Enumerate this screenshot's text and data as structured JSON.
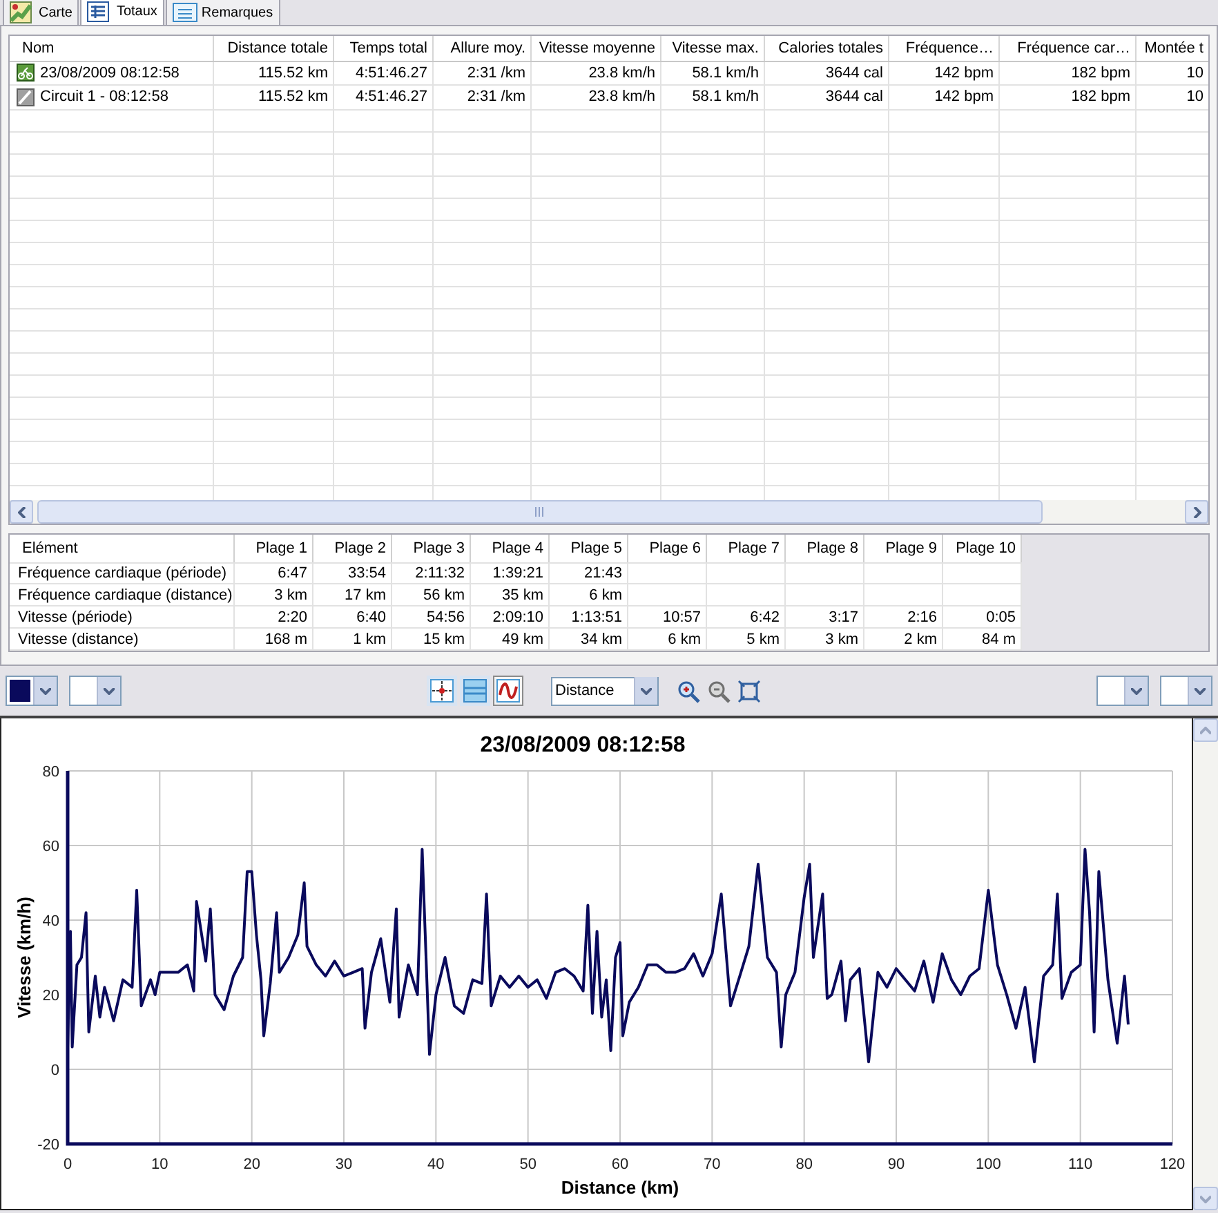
{
  "tabs": [
    {
      "label": "Carte",
      "kind": "map",
      "selected": false
    },
    {
      "label": "Totaux",
      "kind": "table",
      "selected": true
    },
    {
      "label": "Remarques",
      "kind": "notes",
      "selected": false
    }
  ],
  "totals_table": {
    "columns": [
      "Nom",
      "Distance totale",
      "Temps total",
      "Allure moy.",
      "Vitesse moyenne",
      "Vitesse max.",
      "Calories totales",
      "Fréquence…",
      "Fréquence car…",
      "Montée t"
    ],
    "rows": [
      {
        "kind": "activity",
        "cells": [
          "23/08/2009 08:12:58",
          "115.52 km",
          "4:51:46.27",
          "2:31 /km",
          "23.8 km/h",
          "58.1 km/h",
          "3644 cal",
          "142 bpm",
          "182 bpm",
          "10"
        ]
      },
      {
        "kind": "lap",
        "cells": [
          "Circuit 1 - 08:12:58",
          "115.52 km",
          "4:51:46.27",
          "2:31 /km",
          "23.8 km/h",
          "58.1 km/h",
          "3644 cal",
          "142 bpm",
          "182 bpm",
          "10"
        ]
      }
    ]
  },
  "zones_table": {
    "columns": [
      "Elément",
      "Plage 1",
      "Plage 2",
      "Plage 3",
      "Plage 4",
      "Plage 5",
      "Plage 6",
      "Plage 7",
      "Plage 8",
      "Plage 9",
      "Plage 10"
    ],
    "rows": [
      [
        "Fréquence cardiaque (période)",
        "6:47",
        "33:54",
        "2:11:32",
        "1:39:21",
        "21:43"
      ],
      [
        "Fréquence cardiaque (distance)",
        "3 km",
        "17 km",
        "56 km",
        "35 km",
        "6 km"
      ],
      [
        "Vitesse (période)",
        "2:20",
        "6:40",
        "54:56",
        "2:09:10",
        "1:13:51",
        "10:57",
        "6:42",
        "3:17",
        "2:16",
        "0:05"
      ],
      [
        "Vitesse (distance)",
        "168 m",
        "1 km",
        "15 km",
        "49 km",
        "34 km",
        "6 km",
        "5 km",
        "3 km",
        "2 km",
        "84 m"
      ]
    ]
  },
  "toolbar": {
    "toggles": [
      {
        "kind": "crosshair",
        "selected": false
      },
      {
        "kind": "bands",
        "selected": false
      },
      {
        "kind": "curve",
        "selected": true
      }
    ],
    "x_axis": "Distance"
  },
  "chart": {
    "chart_data": {
      "type": "line",
      "grid": true,
      "title": "23/08/2009 08:12:58",
      "xlabel": "Distance (km)",
      "ylabel": "Vitesse (km/h)",
      "xlim": [
        0,
        120
      ],
      "ylim": [
        -20,
        80
      ],
      "xticks": [
        0,
        10,
        20,
        30,
        40,
        50,
        60,
        70,
        80,
        90,
        100,
        110,
        120
      ],
      "yticks": [
        -20,
        0,
        20,
        40,
        60,
        80
      ],
      "x": [
        0,
        0.3,
        0.5,
        1,
        1.5,
        2,
        2.3,
        3,
        3.5,
        4,
        5,
        6,
        7,
        7.5,
        8,
        9,
        9.5,
        10,
        11,
        12,
        13,
        13.7,
        14,
        15,
        15.5,
        16,
        17,
        18,
        19,
        19.5,
        20,
        20.5,
        21,
        21.3,
        22,
        22.7,
        23,
        24,
        25,
        25.7,
        26,
        27,
        28,
        29,
        30,
        31,
        32,
        32.3,
        33,
        34,
        35,
        35.7,
        36,
        37,
        38,
        38.5,
        39,
        39.3,
        40,
        41,
        42,
        43,
        44,
        45,
        45.5,
        46,
        47,
        48,
        49,
        50,
        51,
        52,
        53,
        54,
        55,
        56,
        56.5,
        57,
        57.5,
        58,
        58.5,
        59,
        59.5,
        60,
        60.3,
        61,
        62,
        63,
        64,
        65,
        66,
        67,
        68,
        69,
        70,
        71,
        72,
        73,
        74,
        75,
        76,
        77,
        77.5,
        78,
        79,
        80,
        80.6,
        81,
        82,
        82.5,
        83,
        84,
        84.5,
        85,
        86,
        87,
        88,
        89,
        90,
        91,
        92,
        93,
        94,
        95,
        96,
        97,
        98,
        99,
        100,
        101,
        102,
        103,
        104,
        105,
        106,
        107,
        107.5,
        108,
        109,
        110,
        110.5,
        111,
        111.5,
        112,
        113,
        114,
        114.8,
        115.2
      ],
      "series": [
        {
          "color": "#0a0a5c",
          "values": [
            6,
            37,
            6,
            28,
            30,
            42,
            10,
            25,
            14,
            22,
            13,
            24,
            22,
            48,
            17,
            24,
            20,
            26,
            26,
            26,
            28,
            21,
            45,
            29,
            43,
            20,
            16,
            25,
            30,
            53,
            53,
            36,
            24,
            9,
            23,
            42,
            26,
            30,
            36,
            50,
            33,
            28,
            25,
            29,
            25,
            26,
            27,
            11,
            26,
            35,
            18,
            43,
            14,
            28,
            20,
            59,
            25,
            4,
            20,
            30,
            17,
            15,
            24,
            23,
            47,
            17,
            25,
            22,
            25,
            22,
            24,
            19,
            26,
            27,
            25,
            21,
            44,
            15,
            37,
            14,
            24,
            5,
            30,
            34,
            9,
            18,
            22,
            28,
            28,
            26,
            26,
            27,
            31,
            25,
            31,
            47,
            17,
            25,
            33,
            55,
            30,
            26,
            6,
            20,
            26,
            46,
            55,
            30,
            47,
            19,
            20,
            29,
            13,
            24,
            27,
            2,
            26,
            22,
            27,
            24,
            21,
            29,
            18,
            31,
            24,
            20,
            25,
            27,
            48,
            28,
            20,
            11,
            22,
            2,
            25,
            28,
            47,
            19,
            26,
            28,
            59,
            42,
            10,
            53,
            24,
            7,
            25,
            12
          ]
        }
      ]
    }
  }
}
